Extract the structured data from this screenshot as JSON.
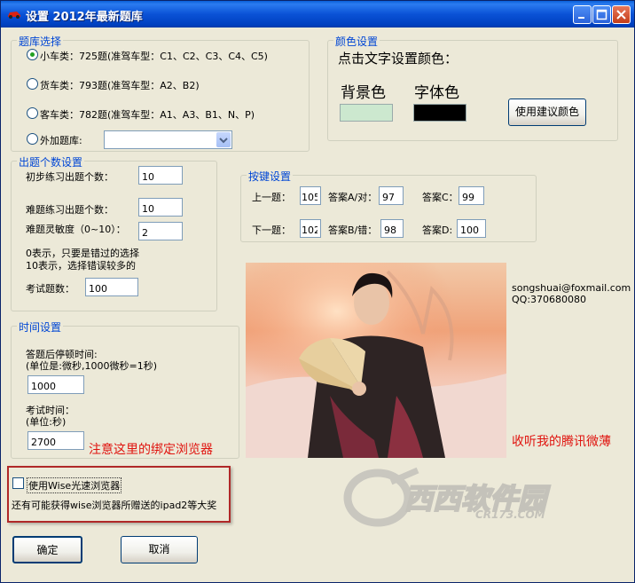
{
  "window": {
    "title": "设置  2012年最新题库"
  },
  "bank_group": {
    "legend": "题库选择",
    "options": [
      {
        "label": "小车类：725题(准驾车型：C1、C2、C3、C4、C5)",
        "selected": true
      },
      {
        "label": "货车类：793题(准驾车型：A2、B2)",
        "selected": false
      },
      {
        "label": "客车类：782题(准驾车型：A1、A3、B1、N、P)",
        "selected": false
      },
      {
        "label": "外加题库:",
        "selected": false
      }
    ],
    "extra_combo_value": ""
  },
  "color_group": {
    "legend": "颜色设置",
    "hint": "点击文字设置颜色：",
    "bg_label": "背景色",
    "fg_label": "字体色",
    "bg_color": "#cce8cf",
    "fg_color": "#000000",
    "suggest_button": "使用建议颜色"
  },
  "count_group": {
    "legend": "出题个数设置",
    "initial_label": "初步练习出题个数：",
    "initial_value": "10",
    "hard_label": "难题练习出题个数：",
    "hard_value": "10",
    "sensitivity_label": "难题灵敏度（0~10）：",
    "sensitivity_value": "2",
    "note_line1": "0表示，只要是错过的选择",
    "note_line2": "10表示，选择错误较多的",
    "exam_label": "考试题数：",
    "exam_value": "100"
  },
  "key_group": {
    "legend": "按键设置",
    "prev_label": "上一题：",
    "prev_value": "105",
    "a_label": "答案A/对：",
    "a_value": "97",
    "c_label": "答案C：",
    "c_value": "99",
    "next_label": "下一题：",
    "next_value": "102",
    "b_label": "答案B/错：",
    "b_value": "98",
    "d_label": "答案D:",
    "d_value": "100"
  },
  "time_group": {
    "legend": "时间设置",
    "pause_label_line1": "答题后停顿时间:",
    "pause_label_line2": "(单位是:微秒,1000微秒=1秒)",
    "pause_value": "1000",
    "exam_time_label_line1": "考试时间：",
    "exam_time_label_line2": "(单位:秒)",
    "exam_time_value": "2700"
  },
  "contact": {
    "email": "songshuai@foxmail.com",
    "qq": "QQ:370680080"
  },
  "annotations": {
    "browser_note": "注意这里的绑定浏览器",
    "weibo_note": "收听我的腾讯微薄"
  },
  "browser": {
    "checkbox_label": "使用Wise光速浏览器",
    "checked": false,
    "promo": "还有可能获得wise浏览器所赠送的ipad2等大奖"
  },
  "watermark": {
    "text": "西西软件园",
    "sub": "CR173.COM"
  },
  "buttons": {
    "ok": "确定",
    "cancel": "取消"
  },
  "colors": {
    "title_bar": "#0a52d6",
    "legend_text": "#0046d5",
    "annotation_red": "#e0140f"
  }
}
